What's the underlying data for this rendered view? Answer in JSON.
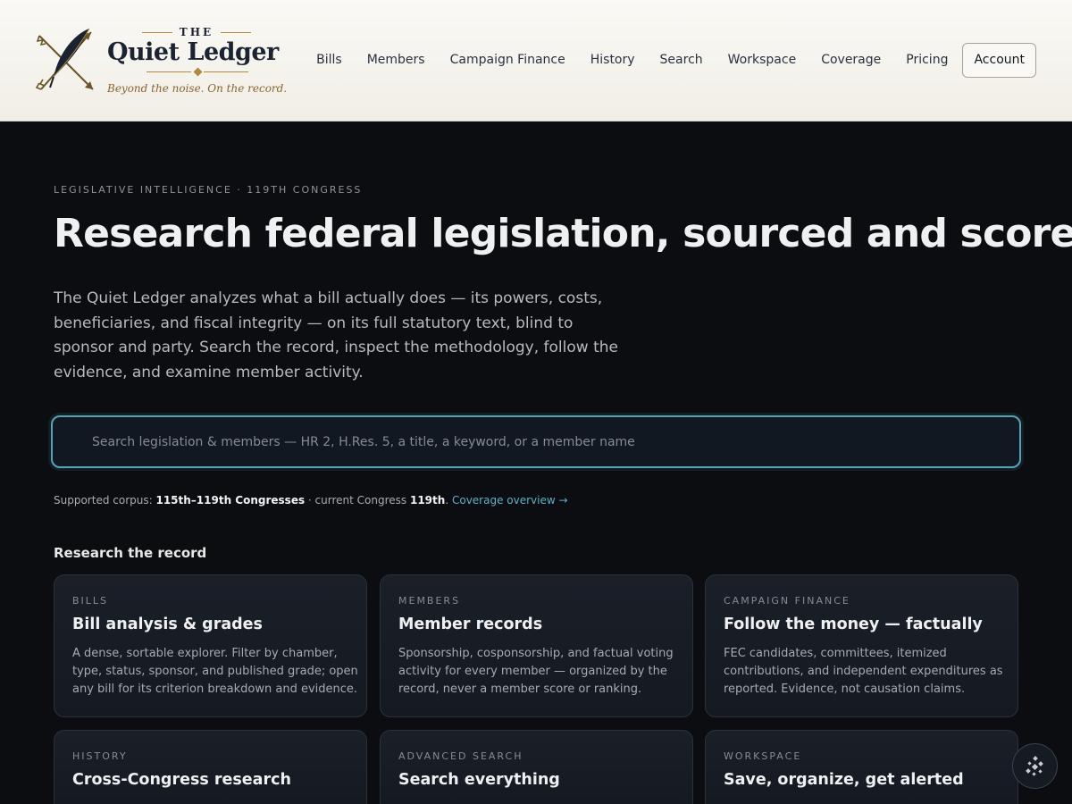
{
  "brand": {
    "the": "THE",
    "name": "Quiet Ledger",
    "tagline": "Beyond the noise. On the record.",
    "logo_icon": "crossed-quill-arrows-icon"
  },
  "nav": {
    "items": [
      {
        "label": "Bills"
      },
      {
        "label": "Members"
      },
      {
        "label": "Campaign Finance"
      },
      {
        "label": "History"
      },
      {
        "label": "Search"
      },
      {
        "label": "Workspace"
      },
      {
        "label": "Coverage"
      },
      {
        "label": "Pricing"
      }
    ],
    "account_label": "Account"
  },
  "hero": {
    "eyebrow": "LEGISLATIVE INTELLIGENCE · 119TH CONGRESS",
    "headline": "Research federal legislation, sourced and scored.",
    "lede": "The Quiet Ledger analyzes what a bill actually does — its powers, costs, beneficiaries, and fiscal integrity — on its full statutory text, blind to sponsor and party. Search the record, inspect the methodology, follow the evidence, and examine member activity."
  },
  "search": {
    "placeholder": "Search legislation & members — HR 2, H.Res. 5, a title, a keyword, or a member name",
    "value": ""
  },
  "corpus": {
    "prefix": "Supported corpus: ",
    "range": "115th–119th Congresses",
    "middle": " · current Congress ",
    "current": "119th",
    "suffix": ".",
    "link": "Coverage overview →"
  },
  "section": {
    "title": "Research the record"
  },
  "cards": [
    {
      "kicker": "BILLS",
      "title": "Bill analysis & grades",
      "desc": "A dense, sortable explorer. Filter by chamber, type, status, sponsor, and published grade; open any bill for its criterion breakdown and evidence."
    },
    {
      "kicker": "MEMBERS",
      "title": "Member records",
      "desc": "Sponsorship, cosponsorship, and factual voting activity for every member — organized by the record, never a member score or ranking."
    },
    {
      "kicker": "CAMPAIGN FINANCE",
      "title": "Follow the money — factually",
      "desc": "FEC candidates, committees, itemized contributions, and independent expenditures as reported. Evidence, not causation claims."
    },
    {
      "kicker": "HISTORY",
      "title": "Cross-Congress research",
      "desc": ""
    },
    {
      "kicker": "ADVANCED SEARCH",
      "title": "Search everything",
      "desc": ""
    },
    {
      "kicker": "WORKSPACE",
      "title": "Save, organize, get alerted",
      "desc": ""
    }
  ],
  "fab": {
    "icon": "sparkle-assistant-icon"
  },
  "colors": {
    "accent": "#58a2b8",
    "gold": "#b08a3e",
    "background": "#0b0d11",
    "header_bg": "#f5f3ed"
  }
}
